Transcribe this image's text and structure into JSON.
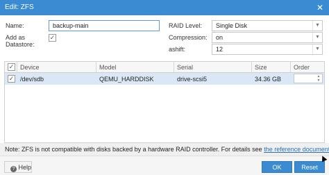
{
  "window": {
    "title": "Edit: ZFS",
    "close_icon": "close-icon"
  },
  "form": {
    "name_label": "Name:",
    "name_value": "backup-main",
    "add_datastore_label": "Add as Datastore:",
    "add_datastore_checked": true,
    "raid_label": "RAID Level:",
    "raid_value": "Single Disk",
    "compression_label": "Compression:",
    "compression_value": "on",
    "ashift_label": "ashift:",
    "ashift_value": "12"
  },
  "grid": {
    "columns": [
      "Device",
      "Model",
      "Serial",
      "Size",
      "Order"
    ],
    "rows": [
      {
        "checked": true,
        "device": "/dev/sdb",
        "model": "QEMU_HARDDISK",
        "serial": "drive-scsi5",
        "size": "34.36 GB",
        "order": ""
      }
    ]
  },
  "note": {
    "prefix": "Note: ZFS is not compatible with disks backed by a hardware RAID controller. For details see",
    "link": "the reference documentation",
    "suffix": "."
  },
  "footer": {
    "help_label": "Help",
    "ok_label": "OK",
    "reset_label": "Reset"
  },
  "colors": {
    "accent": "#3a8bd2",
    "selection": "#d9e7f6"
  }
}
